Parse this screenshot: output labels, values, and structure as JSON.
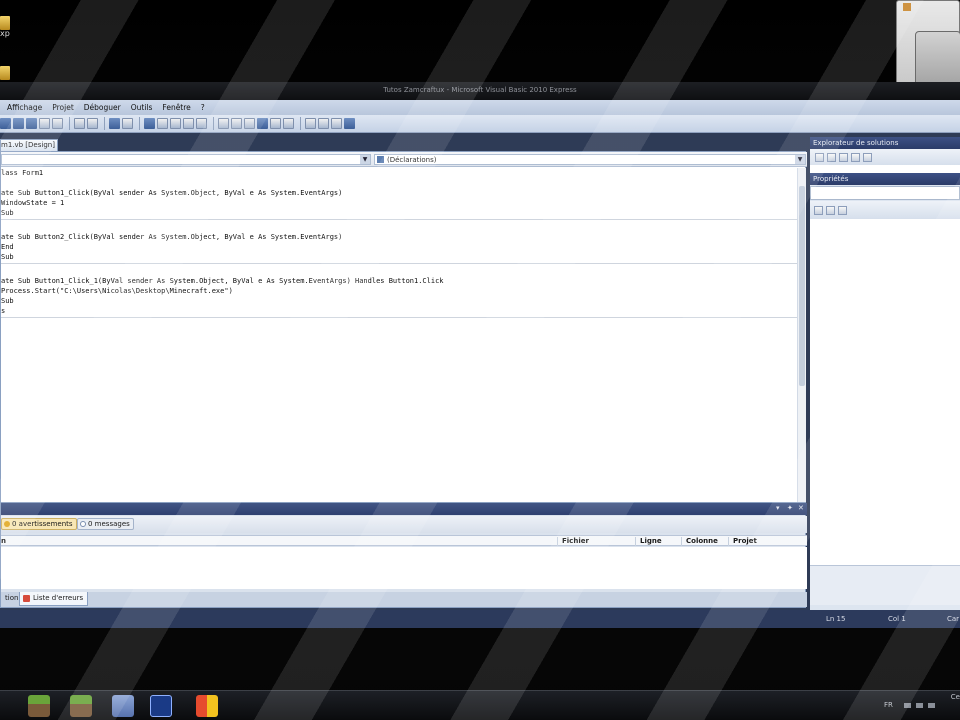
{
  "desktop": {
    "icon1_label": "xp"
  },
  "window": {
    "title": "Tutos Zamcraftux - Microsoft Visual Basic 2010 Express"
  },
  "menu": {
    "items": [
      "Affichage",
      "Projet",
      "Déboguer",
      "Outils",
      "Fenêtre",
      "?"
    ]
  },
  "document": {
    "tab_label": "m1.vb [Design]"
  },
  "navbar": {
    "left_value": "",
    "right_value": "(Déclarations)"
  },
  "code": {
    "lines": [
      "lass Form1",
      "",
      "ate Sub Button1_Click(ByVal sender As System.Object, ByVal e As System.EventArgs)",
      "WindowState = 1",
      "Sub",
      "",
      "ate Sub Button2_Click(ByVal sender As System.Object, ByVal e As System.EventArgs)",
      "End",
      "Sub",
      "",
      "ate Sub Button1_Click_1(ByVal sender As System.Object, ByVal e As System.EventArgs) Handles Button1.Click",
      "Process.Start(\"C:\\Users\\Nicolas\\Desktop\\Minecraft.exe\")",
      "Sub",
      "s"
    ]
  },
  "error_list": {
    "warnings_label": "0 avertissements",
    "messages_label": "0 messages",
    "columns": [
      "n",
      "Fichier",
      "Ligne",
      "Colonne",
      "Projet"
    ],
    "tabs": [
      "tion",
      "Liste d'erreurs"
    ]
  },
  "side": {
    "solution_title": "Explorateur de solutions",
    "properties_title": "Propriétés"
  },
  "status": {
    "ln": "Ln 15",
    "col": "Col 1",
    "ch": "Car"
  },
  "taskbar": {
    "lang": "FR",
    "clock_snippet": "Ce"
  }
}
